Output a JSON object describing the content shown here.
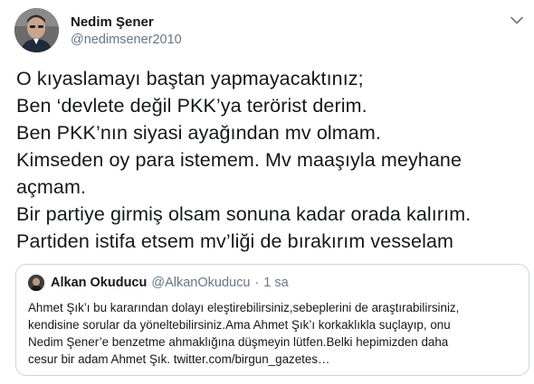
{
  "author": {
    "display_name": "Nedim Şener",
    "handle": "@nedimsener2010"
  },
  "menu_icon": "chevron-down-icon",
  "tweet_lines": [
    "O kıyaslamayı baştan yapmayacaktınız;",
    "Ben ‘devlete değil PKK’ya terörist derim.",
    "Ben PKK’nın siyasi ayağından mv olmam.",
    "Kimseden oy para istemem. Mv maaşıyla meyhane",
    "açmam.",
    "Bir partiye girmiş olsam sonuna kadar orada kalırım.",
    "Partiden istifa etsem mv’liği de bırakırım vesselam"
  ],
  "quoted_tweet": {
    "display_name": "Alkan Okuducu",
    "handle": "@AlkanOkuducu",
    "separator": "·",
    "time": "1 sa",
    "lines": [
      "Ahmet Şık’ı bu kararından dolayı eleştirebilirsiniz,sebeplerini de araştırabilirsiniz,",
      "kendisine sorular da yöneltebilirsiniz.Ama Ahmet Şık’ı korkaklıkla suçlayıp, onu",
      "Nedim Şener’e benzetme ahmaklığına düşmeyin lütfen.Belki hepimizden daha",
      "cesur bir adam Ahmet Şık. twitter.com/birgun_gazetes…"
    ]
  },
  "colors": {
    "text": "#14171a",
    "secondary": "#657786",
    "border": "#ccd6dd"
  }
}
